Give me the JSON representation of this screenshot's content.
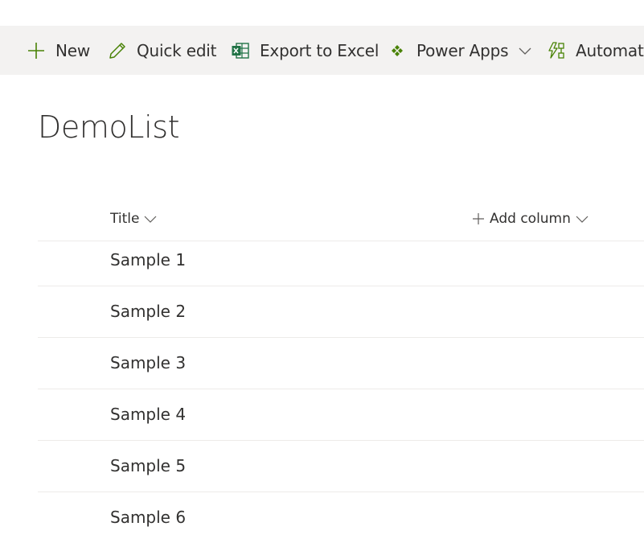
{
  "toolbar": {
    "new_label": "New",
    "quick_edit_label": "Quick edit",
    "export_label": "Export to Excel",
    "power_apps_label": "Power Apps",
    "automate_label": "Automate"
  },
  "page": {
    "title": "DemoList"
  },
  "list": {
    "columns": {
      "title": "Title",
      "add_column": "Add column"
    },
    "rows": [
      "Sample 1",
      "Sample 2",
      "Sample 3",
      "Sample 4",
      "Sample 5",
      "Sample 6"
    ]
  },
  "colors": {
    "accent_green": "#498205",
    "excel_green": "#217346",
    "toolbar_bg": "#f3f2f1",
    "text": "#323130",
    "divider": "#edebe9"
  }
}
